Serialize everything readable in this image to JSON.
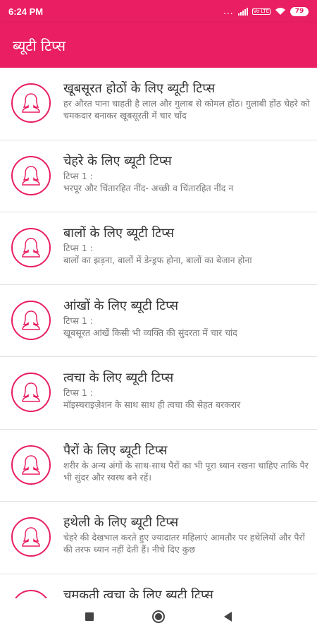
{
  "status_bar": {
    "time": "6:24 PM",
    "dots": "...",
    "volte": "Vo LTE",
    "battery": "79"
  },
  "app_bar": {
    "title": "ब्यूटी टिप्स"
  },
  "items": [
    {
      "title": "खूबसूरत होठों के लिए ब्यूटी टिप्स",
      "desc": "हर औरत पाना चाहती है लाल और गुलाब से कोमल होंठ। गुलाबी होंठ चेहरे को चमकदार बनाकर खूबसूरती में चार चाँद"
    },
    {
      "title": "चेहरे के लिए ब्यूटी टिप्स",
      "desc": "टिप्स 1 :\nभरपूर और चिंतारहित नींद- अच्छी व चिंतारहित नींद न"
    },
    {
      "title": "बालों के लिए ब्यूटी टिप्स",
      "desc": "टिप्स 1 :\nबालों का झड़ना, बालों में डेन्ड्रफ होना, बालों का बेजान होना"
    },
    {
      "title": "आंखों के लिए ब्यूटी टिप्स",
      "desc": "टिप्स 1 :\nखूबसूरत आंखें किसी भी व्यक्ति की सुंदरता में चार चांद"
    },
    {
      "title": "त्वचा के लिए ब्यूटी टिप्स",
      "desc": "टिप्स 1 :\nमॉइस्चराइज़ेशन के साथ साथ ही त्वचा की सेहत बरकरार"
    },
    {
      "title": "पैरों के लिए ब्यूटी टिप्स",
      "desc": "शरीर के अन्य अंगों के साथ-साथ पैरों का भी पूरा ध्यान रखना चाहिए ताकि पैर भी सुंदर और स्वस्थ बने रहें।"
    },
    {
      "title": "हथेली के लिए ब्यूटी टिप्स",
      "desc": "चेहरे की देखभाल करते हुए ज्यादातर महिलाएं आमतौर पर हथेलियों और पैरों की तरफ ध्यान नहीं देती हैं। नीचे दिए कुछ"
    },
    {
      "title": "चमकती त्वचा के लिए ब्यूटी टिप्स",
      "desc": ""
    }
  ],
  "colors": {
    "accent": "#e91e63",
    "divider": "#e0e0e0"
  },
  "icons": {
    "avatar": "woman-silhouette-icon"
  }
}
